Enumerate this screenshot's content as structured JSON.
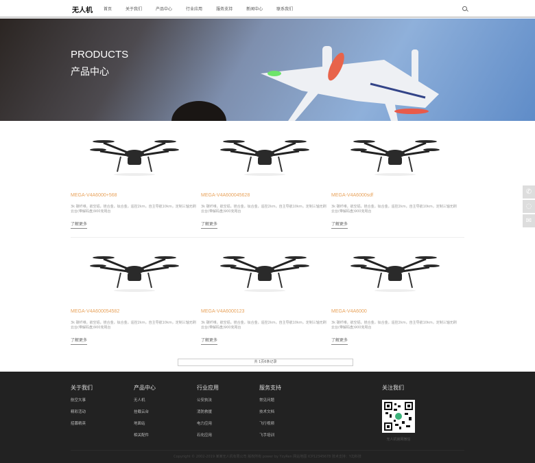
{
  "header": {
    "logo": "无人机",
    "nav": [
      "首页",
      "关于我们",
      "产品中心",
      "行业应用",
      "服务支持",
      "新闻中心",
      "联系我们"
    ]
  },
  "banner": {
    "en": "PRODUCTS",
    "cn": "产品中心"
  },
  "products": [
    {
      "title": "MEGA-V4A6000+568",
      "desc": "3k 碳纤维，航空铝，镁合金，钛合金，遥控2km，自主导航10km，定制三轴无刷云台(带解码盘)900克甩台",
      "more": "了解更多"
    },
    {
      "title": "MEGA-V4A600045628",
      "desc": "3k 碳纤维，航空铝，镁合金，钛合金，遥控2km，自主导航10km，定制三轴无刷云台(带解码盘)900克甩台",
      "more": "了解更多"
    },
    {
      "title": "MEGA-V4A6000sdf",
      "desc": "3k 碳纤维，航空铝，镁合金，钛合金，遥控2km，自主导航10km，定制三轴无刷云台(带解码盘)900克甩台",
      "more": "了解更多"
    },
    {
      "title": "MEGA-V4A600054582",
      "desc": "3k 碳纤维，航空铝，镁合金，钛合金，遥控2km，自主导航10km，定制三轴无刷云台(带解码盘)900克甩台",
      "more": "了解更多"
    },
    {
      "title": "MEGA-V4A6000123",
      "desc": "3k 碳纤维，航空铝，镁合金，钛合金，遥控2km，自主导航10km，定制三轴无刷云台(带解码盘)900克甩台",
      "more": "了解更多"
    },
    {
      "title": "MEGA-V4A6000",
      "desc": "3k 碳纤维，航空铝，镁合金，钛合金，遥控2km，自主导航10km，定制三轴无刷云台(带解码盘)900克甩台",
      "more": "了解更多"
    }
  ],
  "pager": "共 1页6条记录",
  "footer": {
    "cols": [
      {
        "title": "关于我们",
        "links": [
          "航空大事",
          "精彩活动",
          "招募精英"
        ]
      },
      {
        "title": "产品中心",
        "links": [
          "无人机",
          "挂载云台",
          "地面站",
          "相关配件"
        ]
      },
      {
        "title": "行业应用",
        "links": [
          "公安执法",
          "消防救援",
          "电力应用",
          "石化应用"
        ]
      },
      {
        "title": "服务支持",
        "links": [
          "常见问题",
          "技术文档",
          "飞行视频",
          "飞手培训"
        ]
      }
    ],
    "follow": "关注我们",
    "qr_caption": "无人机官网微信",
    "copyright": "Copyright © 2002-2019 某某无人机有限公司 版权所有 power by YzyRen  网站地图  ICP12345678  技术支持：YZJ科技"
  }
}
